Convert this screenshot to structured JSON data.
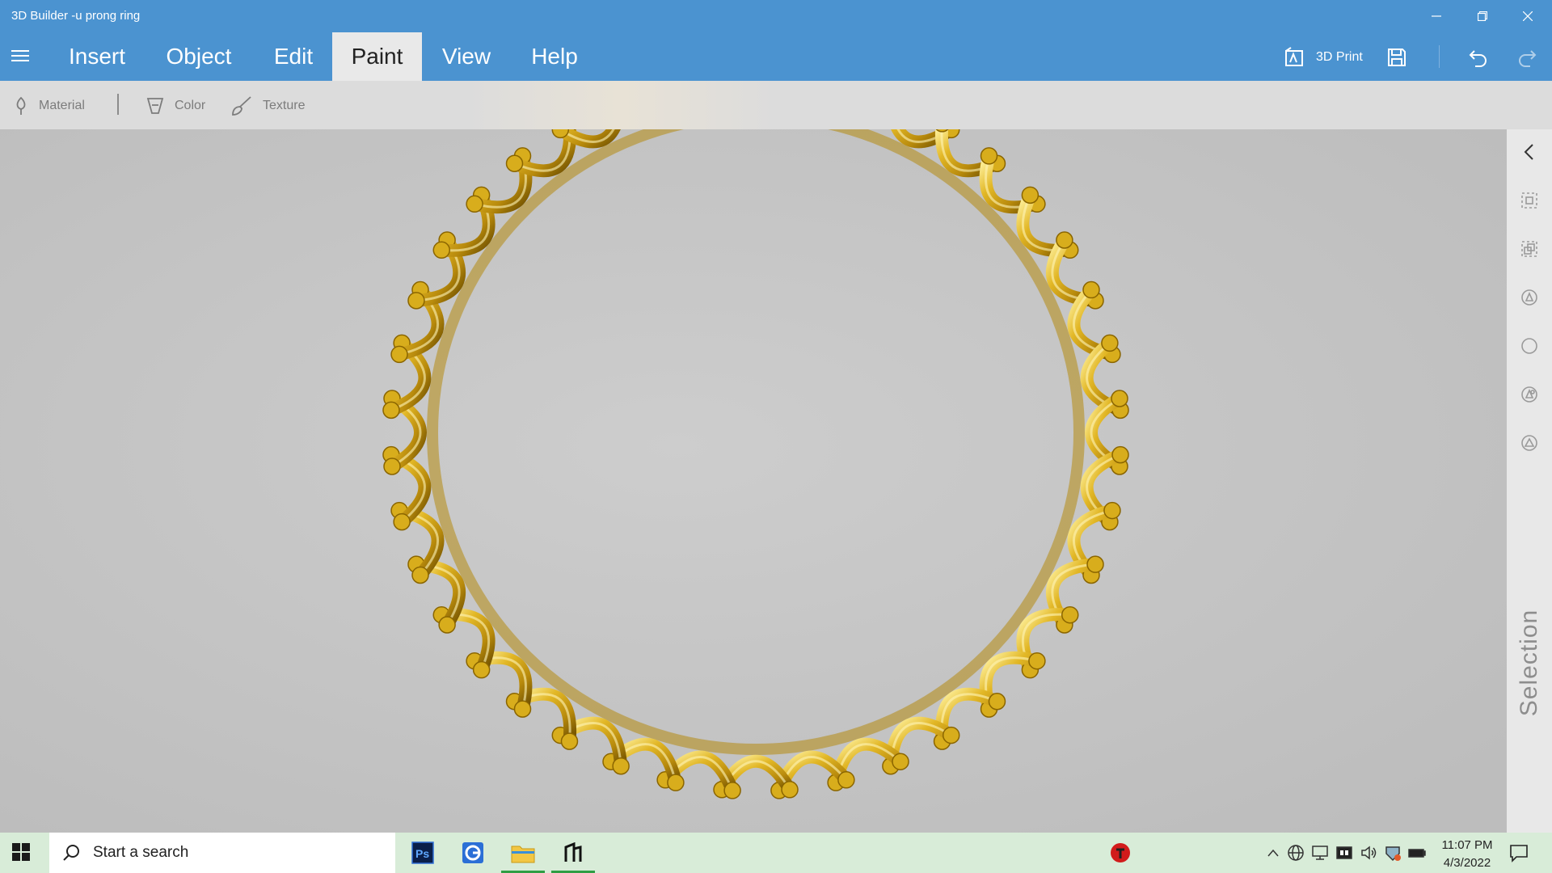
{
  "window": {
    "title": "3D Builder -u prong ring"
  },
  "menu": {
    "tabs": [
      {
        "label": "Insert"
      },
      {
        "label": "Object"
      },
      {
        "label": "Edit"
      },
      {
        "label": "Paint"
      },
      {
        "label": "View"
      },
      {
        "label": "Help"
      }
    ],
    "active_tab": "Paint"
  },
  "toolbar": {
    "print_label": "3D Print"
  },
  "ribbon": {
    "material_label": "Material",
    "color_label": "Color",
    "texture_label": "Texture"
  },
  "side_panel": {
    "label": "Selection"
  },
  "taskbar": {
    "search_placeholder": "Start a search",
    "apps": [
      "photoshop-icon",
      "chrome-icon",
      "file-explorer-icon",
      "3d-builder-icon"
    ],
    "clock_time": "11:07 PM",
    "clock_date": "4/3/2022"
  },
  "colors": {
    "title_bar": "#4b93d0",
    "ribbon": "#dcdcdc",
    "viewport": "#c4c4c4",
    "model_gold": "#d4a917",
    "taskbar": "#d8ecd8"
  }
}
